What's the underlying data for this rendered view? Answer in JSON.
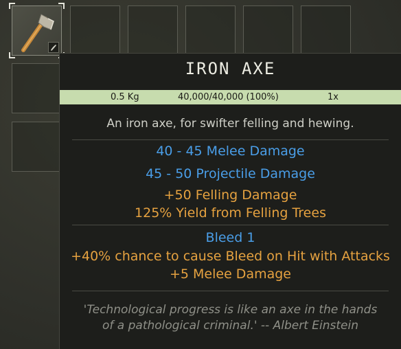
{
  "inventory": {
    "selected_item_icon": "axe-icon",
    "selected_badge_icon": "dye-brush-icon"
  },
  "tooltip": {
    "title": "IRON AXE",
    "weight": "0.5 Kg",
    "durability": "40,000/40,000 (100%)",
    "quantity": "1x",
    "description": "An iron axe, for swifter felling and hewing.",
    "stats": {
      "melee_damage": "40 - 45 Melee Damage",
      "projectile_damage": "45 - 50 Projectile Damage",
      "felling_damage": "+50 Felling Damage",
      "yield": "125% Yield from Felling Trees"
    },
    "bleed": {
      "title": "Bleed 1",
      "chance": "+40% chance to cause Bleed on Hit with Attacks",
      "melee": "+5 Melee Damage"
    },
    "quote_line1": "'Technological progress is like an axe in the hands",
    "quote_line2": "of a pathological criminal.' -- Albert Einstein"
  },
  "colors": {
    "accent_blue": "#4a9ee8",
    "accent_orange": "#e6a240",
    "bar_green": "#c7dcae"
  }
}
